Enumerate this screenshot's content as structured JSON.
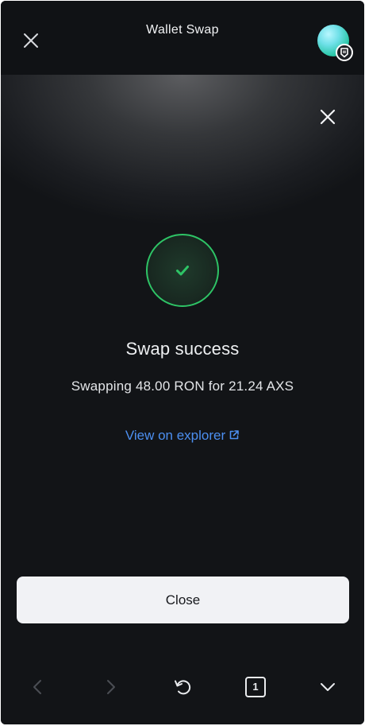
{
  "header": {
    "title": "Wallet Swap",
    "close_icon": "close-icon",
    "avatar_icon": "avatar-icon"
  },
  "result": {
    "title": "Swap success",
    "detail": "Swapping 48.00 RON for 21.24 AXS",
    "link_label": "View on explorer",
    "status_color": "#2ec466",
    "link_color": "#4c8ff0"
  },
  "footer": {
    "close_label": "Close"
  },
  "nav": {
    "back_icon": "chevron-left-icon",
    "forward_icon": "chevron-right-icon",
    "reload_icon": "refresh-icon",
    "tab_count": "1",
    "collapse_icon": "chevron-down-icon"
  }
}
